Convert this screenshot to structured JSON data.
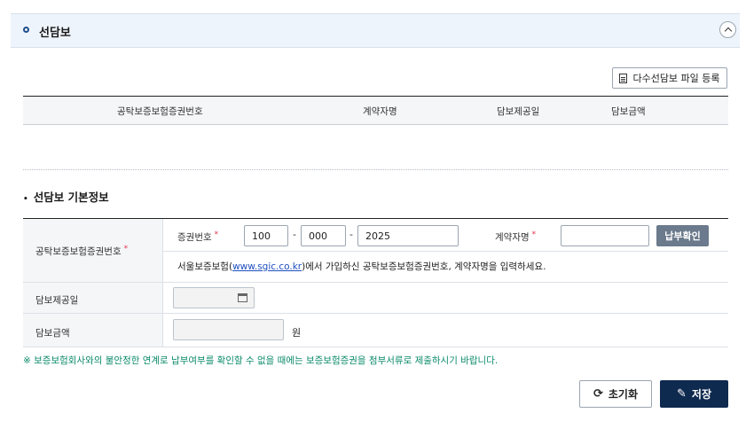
{
  "section": {
    "title": "선담보",
    "collapse_icon": "chevron-up-icon"
  },
  "toolbar": {
    "multi_upload_label": "다수선담보 파일 등록",
    "multi_upload_icon": "file-list-icon"
  },
  "list_table": {
    "columns": [
      "공탁보증보험증권번호",
      "계약자명",
      "담보제공일",
      "담보금액"
    ],
    "rows": []
  },
  "form": {
    "title": "선담보 기본정보",
    "bond_number_label": "공탁보증보험증권번호",
    "cert_no_label": "증권번호",
    "cert_no_part1": "100",
    "cert_no_part2": "000",
    "cert_no_part3": "2025",
    "dash": "-",
    "contractor_label": "계약자명",
    "contractor_value": "",
    "payment_check_button": "납부확인",
    "guide_prefix": "서울보증보험(",
    "guide_link": "www.sgic.co.kr",
    "guide_suffix": ")에서 가입하신 공탁보증보험증권번호, 계약자명을 입력하세요.",
    "provide_date_label": "담보제공일",
    "provide_date_value": "",
    "amount_label": "담보금액",
    "amount_value": "",
    "amount_unit": "원",
    "required_mark": "*"
  },
  "notice": "※ 보증보험회사와의 불안정한 연계로 납부여부를 확인할 수 없을 때에는 보증보험증권을 첨부서류로 제출하시기 바랍니다.",
  "actions": {
    "reset_label": "초기화",
    "reset_icon": "refresh-icon",
    "save_label": "저장",
    "save_icon": "pencil-icon"
  },
  "colors": {
    "primary": "#0f2a4f",
    "notice": "#0a8a6a",
    "required": "#e0334c",
    "link": "#1f4fbf"
  }
}
